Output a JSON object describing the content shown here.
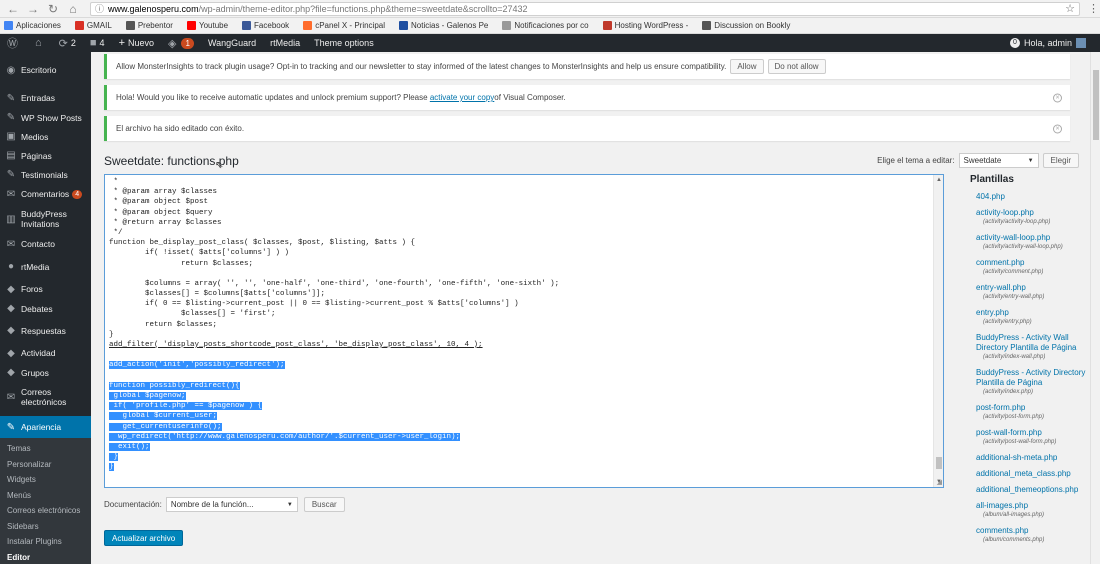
{
  "browser": {
    "url_host": "www.galenosperu.com",
    "url_path": "/wp-admin/theme-editor.php?file=functions.php&theme=sweetdate&scrollto=27432",
    "bookmarks": [
      {
        "label": "Aplicaciones",
        "color": "#4285f4"
      },
      {
        "label": "GMAIL",
        "color": "#d93025"
      },
      {
        "label": "Prebentor",
        "color": "#555555"
      },
      {
        "label": "Youtube",
        "color": "#ff0000"
      },
      {
        "label": "Facebook",
        "color": "#3b5998"
      },
      {
        "label": "cPanel X - Principal",
        "color": "#ff6c2c"
      },
      {
        "label": "Noticias - Galenos Pe",
        "color": "#1e4ea1"
      },
      {
        "label": "Notificaciones por co",
        "color": "#999999"
      },
      {
        "label": "Hosting WordPress -",
        "color": "#c0392b"
      },
      {
        "label": "Discussion on Bookly",
        "color": "#555555"
      }
    ]
  },
  "adminbar": {
    "updates": "2",
    "comments": "4",
    "new_label": "Nuevo",
    "wg_badge": "1",
    "wangguard": "WangGuard",
    "rtmedia": "rtMedia",
    "theme_options": "Theme options",
    "user_count": "0",
    "greeting": "Hola, admin"
  },
  "sidebar": {
    "items": [
      {
        "label": "Escritorio",
        "icon": "◉",
        "height": 24,
        "top_pad": 6
      },
      {
        "label": "Entradas",
        "icon": "✎",
        "height": 20,
        "top_pad": 6
      },
      {
        "label": "WP Show Posts",
        "icon": "✎",
        "height": 19
      },
      {
        "label": "Medios",
        "icon": "▣",
        "height": 19
      },
      {
        "label": "Páginas",
        "icon": "▤",
        "height": 19
      },
      {
        "label": "Testimonials",
        "icon": "✎",
        "height": 19
      },
      {
        "label": "Comentarios",
        "icon": "✉",
        "height": 20,
        "badge": "4"
      },
      {
        "label": "BuddyPress Invitations",
        "icon": "▥",
        "height": 30
      },
      {
        "label": "Contacto",
        "icon": "✉",
        "height": 20
      },
      {
        "label": "rtMedia",
        "icon": "●",
        "height": 25
      },
      {
        "label": "Foros",
        "icon": "◆",
        "height": 20
      },
      {
        "label": "Debates",
        "icon": "◆",
        "height": 19
      },
      {
        "label": "Respuestas",
        "icon": "◆",
        "height": 25
      },
      {
        "label": "Actividad",
        "icon": "◆",
        "height": 20
      },
      {
        "label": "Grupos",
        "icon": "◆",
        "height": 19
      },
      {
        "label": "Correos electrónicos",
        "icon": "✉",
        "height": 30
      }
    ],
    "active": {
      "label": "Apariencia",
      "icon": "✎"
    },
    "submenu": [
      "Temas",
      "Personalizar",
      "Widgets",
      "Menús",
      "Correos electrónicos",
      "Sidebars",
      "Instalar Plugins",
      "Editor"
    ],
    "current_submenu": "Editor"
  },
  "notices": {
    "monsterinsights": "Allow MonsterInsights to track plugin usage? Opt-in to tracking and our newsletter to stay informed of the latest changes to MonsterInsights and help us ensure compatibility.",
    "allow": "Allow",
    "do_not_allow": "Do not allow",
    "vc_before": "Hola! Would you like to receive automatic updates and unlock premium support? Please ",
    "vc_link": "activate your copy",
    "vc_after": " of Visual Composer.",
    "saved": "El archivo ha sido editado con éxito."
  },
  "editor": {
    "title": "Sweetdate: functions.php",
    "theme_label": "Elige el tema a editar:",
    "theme_selected": "Sweetdate",
    "select_button": "Elegir",
    "code_lines": [
      {
        "t": " *"
      },
      {
        "t": " * @param array $classes"
      },
      {
        "t": " * @param object $post"
      },
      {
        "t": " * @param object $query"
      },
      {
        "t": " * @return array $classes"
      },
      {
        "t": " */"
      },
      {
        "t": "function be_display_post_class( $classes, $post, $listing, $atts ) {"
      },
      {
        "t": "        if( !isset( $atts['columns'] ) )"
      },
      {
        "t": "                return $classes;"
      },
      {
        "t": ""
      },
      {
        "t": "        $columns = array( '', '', 'one-half', 'one-third', 'one-fourth', 'one-fifth', 'one-sixth' );"
      },
      {
        "t": "        $classes[] = $columns[$atts['columns']];"
      },
      {
        "t": "        if( 0 == $listing->current_post || 0 == $listing->current_post % $atts['columns'] )"
      },
      {
        "t": "                $classes[] = 'first';"
      },
      {
        "t": "        return $classes;"
      },
      {
        "t": "}"
      },
      {
        "t": "add_filter( 'display_posts_shortcode_post_class', 'be_display_post_class', 10, 4 );",
        "u": true
      },
      {
        "t": ""
      },
      {
        "t": "add_action('init','possibly_redirect');",
        "sel": true
      },
      {
        "t": ""
      },
      {
        "t": "function possibly_redirect(){",
        "sel": true
      },
      {
        "t": " global $pagenow;",
        "sel": true
      },
      {
        "t": " if( 'profile.php' == $pagenow ) {",
        "sel": true
      },
      {
        "t": "   global $current_user;",
        "sel": true
      },
      {
        "t": "   get_currentuserinfo();",
        "sel": true
      },
      {
        "t": "  wp_redirect('http://www.galenosperu.com/author/'.$current_user->user_login);",
        "sel": true
      },
      {
        "t": "  exit();",
        "sel": true
      },
      {
        "t": " }",
        "sel": true
      },
      {
        "t": "}",
        "sel": true
      }
    ],
    "doc_label": "Documentación:",
    "doc_placeholder": "Nombre de la función...",
    "lookup_button": "Buscar",
    "update_button": "Actualizar archivo"
  },
  "templates": {
    "heading": "Plantillas",
    "items": [
      {
        "name": "404.php"
      },
      {
        "name": "activity-loop.php",
        "path": "(activity/activity-loop.php)"
      },
      {
        "name": "activity-wall-loop.php",
        "path": "(activity/activity-wall-loop.php)"
      },
      {
        "name": "comment.php",
        "path": "(activity/comment.php)"
      },
      {
        "name": "entry-wall.php",
        "path": "(activity/entry-wall.php)"
      },
      {
        "name": "entry.php",
        "path": "(activity/entry.php)"
      },
      {
        "name": "BuddyPress - Activity Wall Directory Plantilla de Página",
        "path": "(activity/index-wall.php)"
      },
      {
        "name": "BuddyPress - Activity Directory Plantilla de Página",
        "path": "(activity/index.php)"
      },
      {
        "name": "post-form.php",
        "path": "(activity/post-form.php)"
      },
      {
        "name": "post-wall-form.php",
        "path": "(activity/post-wall-form.php)"
      },
      {
        "name": "additional-sh-meta.php"
      },
      {
        "name": "additional_meta_class.php"
      },
      {
        "name": "additional_themeoptions.php"
      },
      {
        "name": "all-images.php",
        "path": "(album/all-images.php)"
      },
      {
        "name": "comments.php",
        "path": "(album/comments.php)"
      }
    ]
  }
}
